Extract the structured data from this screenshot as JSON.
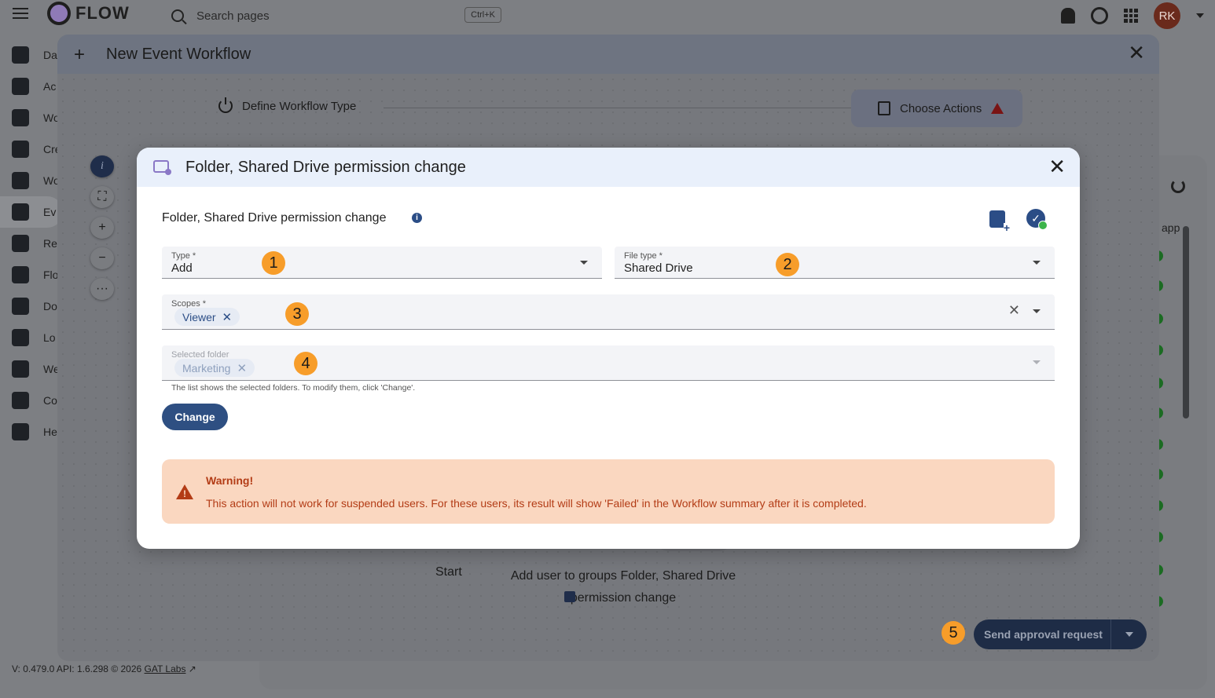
{
  "app": {
    "name": "FLOW",
    "search_placeholder": "Search pages",
    "search_shortcut": "Ctrl+K",
    "user_initials": "RK",
    "version_text": "V: 0.479.0   API: 1.6.298   © 2026",
    "company_link": "GAT Labs",
    "sidebar": [
      "Da",
      "Ac",
      "Wo",
      "Cre",
      "Wo",
      "Ev",
      "Re",
      "Flo",
      "Do",
      "Lo",
      "We",
      "Co",
      "He"
    ],
    "bg_table_header": "app"
  },
  "workflow_dialog": {
    "title": "New Event Workflow",
    "steps": [
      {
        "label": "Define Workflow Type"
      },
      {
        "label": "Choose Actions"
      }
    ],
    "node_start": "Start",
    "node_action": "Add user to groups Folder, Shared Drive permission change",
    "send_button": "Send approval request"
  },
  "modal": {
    "title": "Folder, Shared Drive permission change",
    "subtitle": "Folder, Shared Drive permission change",
    "fields": {
      "type": {
        "label": "Type *",
        "value": "Add"
      },
      "file_type": {
        "label": "File type *",
        "value": "Shared Drive"
      },
      "scopes": {
        "label": "Scopes *",
        "chips": [
          "Viewer"
        ]
      },
      "selected_folder": {
        "label": "Selected folder",
        "chips": [
          "Marketing"
        ],
        "helper": "The list shows the selected folders. To modify them, click 'Change'."
      }
    },
    "change_button": "Change",
    "warning": {
      "title": "Warning!",
      "message": "This action will not work for suspended users. For these users, its result will show 'Failed' in the Workflow summary after it is completed."
    }
  },
  "badges": [
    "1",
    "2",
    "3",
    "4",
    "5"
  ],
  "colors": {
    "primary": "#2e4f82",
    "warning_bg": "#fad7c0",
    "warning_text": "#b33c16",
    "badge": "#f79d2a",
    "modal_header": "#e9f0fb"
  }
}
